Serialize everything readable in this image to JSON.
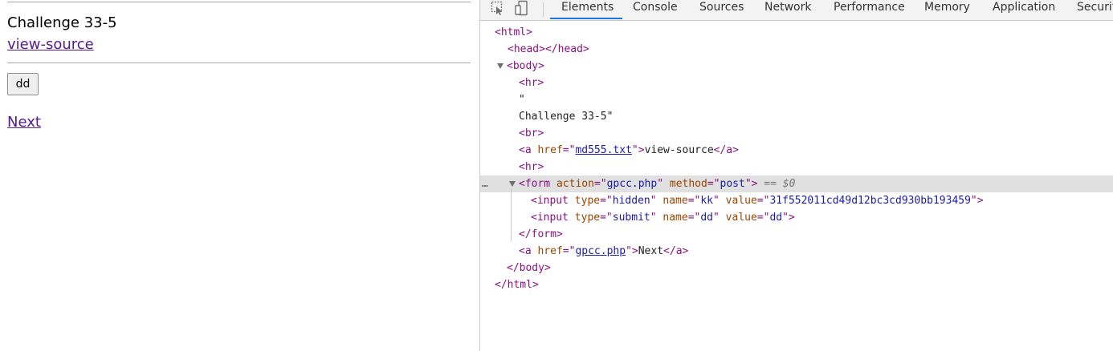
{
  "page": {
    "challenge_text": "Challenge 33-5",
    "view_source_link": "view-source",
    "dd_button": "dd",
    "next_link": "Next"
  },
  "devtools": {
    "tabs": [
      "Elements",
      "Console",
      "Sources",
      "Network",
      "Performance",
      "Memory",
      "Application",
      "Securit"
    ],
    "active_tab": "Elements",
    "dom": {
      "html_open": "<html>",
      "head": [
        "<head>",
        "</head>"
      ],
      "body_open": "<body>",
      "hr": "<hr>",
      "quote": "\"",
      "text_node": "Challenge 33-5\"",
      "br": "<br>",
      "a1": {
        "open": "<a",
        "attr": "href",
        "eq": "=\"",
        "value": "md555.txt",
        "close": "\">",
        "text": "view-source",
        "end": "</a>"
      },
      "form": {
        "open": "<form",
        "attr1": "action",
        "value1": "gpcc.php",
        "attr2": "method",
        "value2": "post",
        "close": ">",
        "marker": "== $0",
        "end": "</form>"
      },
      "input1": {
        "open": "<input",
        "a1": "type",
        "v1": "hidden",
        "a2": "name",
        "v2": "kk",
        "a3": "value",
        "v3": "31f552011cd49d12bc3cd930bb193459",
        "close": ">"
      },
      "input2": {
        "open": "<input",
        "a1": "type",
        "v1": "submit",
        "a2": "name",
        "v2": "dd",
        "a3": "value",
        "v3": "dd",
        "close": ">"
      },
      "a2": {
        "open": "<a",
        "attr": "href",
        "value": "gpcc.php",
        "text": "Next",
        "end": "</a>"
      },
      "body_close": "</body>",
      "html_close": "</html>",
      "dots": "…"
    }
  }
}
